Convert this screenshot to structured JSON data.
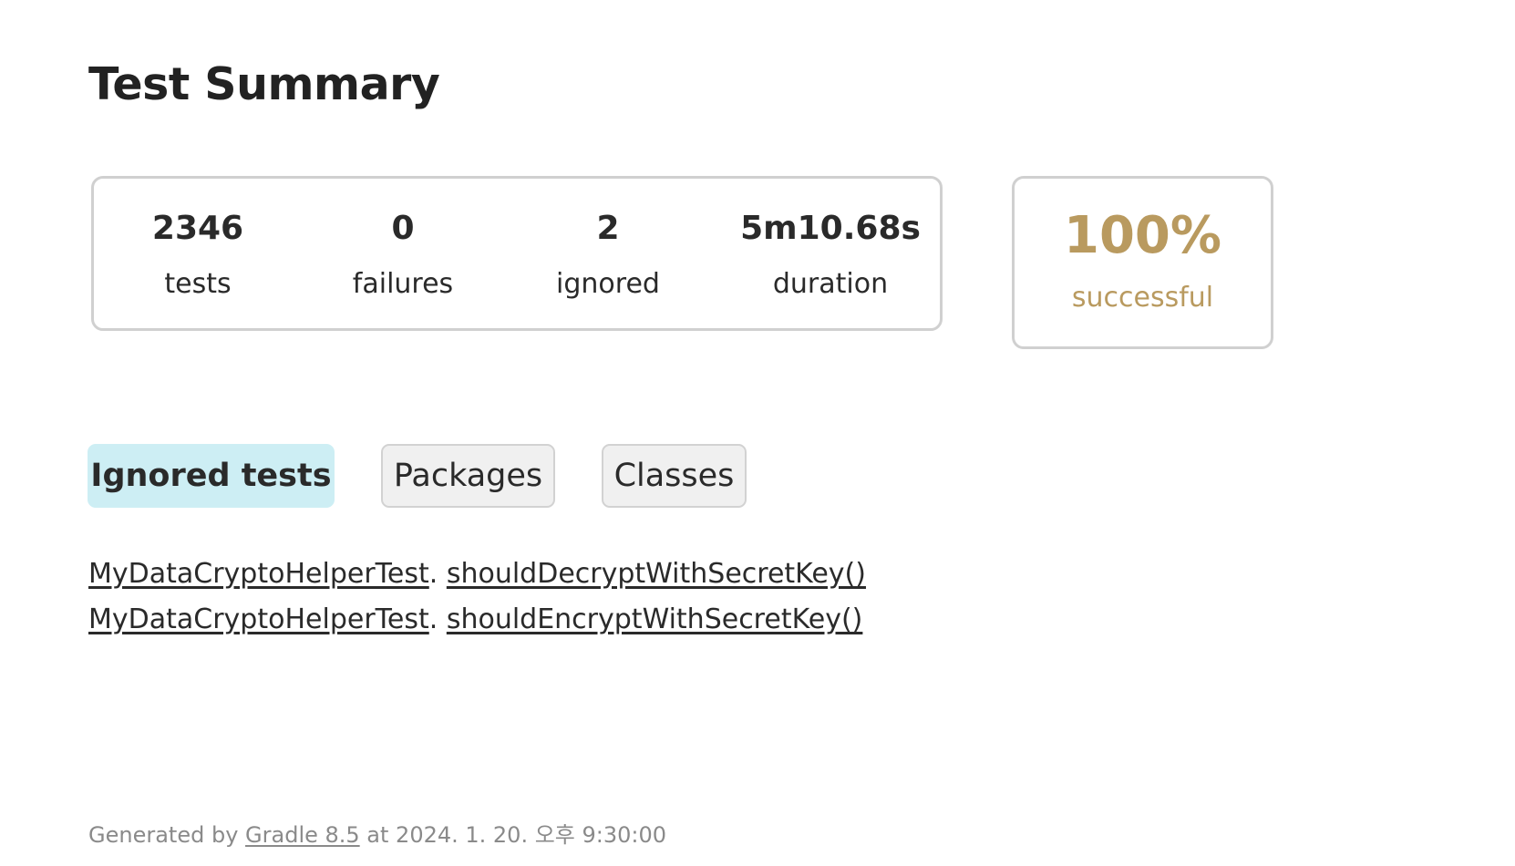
{
  "page": {
    "title": "Test Summary"
  },
  "summary": {
    "tests": {
      "value": "2346",
      "label": "tests"
    },
    "failures": {
      "value": "0",
      "label": "failures"
    },
    "ignored": {
      "value": "2",
      "label": "ignored"
    },
    "duration": {
      "value": "5m10.68s",
      "label": "duration"
    }
  },
  "success_rate": {
    "value": "100%",
    "label": "successful",
    "color": "#b99a5f"
  },
  "tabs": [
    {
      "label": "Ignored tests",
      "selected": true,
      "color": "#cdeef4"
    },
    {
      "label": "Packages",
      "selected": false
    },
    {
      "label": "Classes",
      "selected": false
    }
  ],
  "ignored_tests": [
    {
      "class": "MyDataCryptoHelperTest",
      "separator": ".",
      "method": "shouldDecryptWithSecretKey()"
    },
    {
      "class": "MyDataCryptoHelperTest",
      "separator": ".",
      "method": "shouldEncryptWithSecretKey()"
    }
  ],
  "footer": {
    "prefix": "Generated by ",
    "link": "Gradle 8.5",
    "suffix": " at 2024. 1. 20. 오후 9:30:00"
  }
}
